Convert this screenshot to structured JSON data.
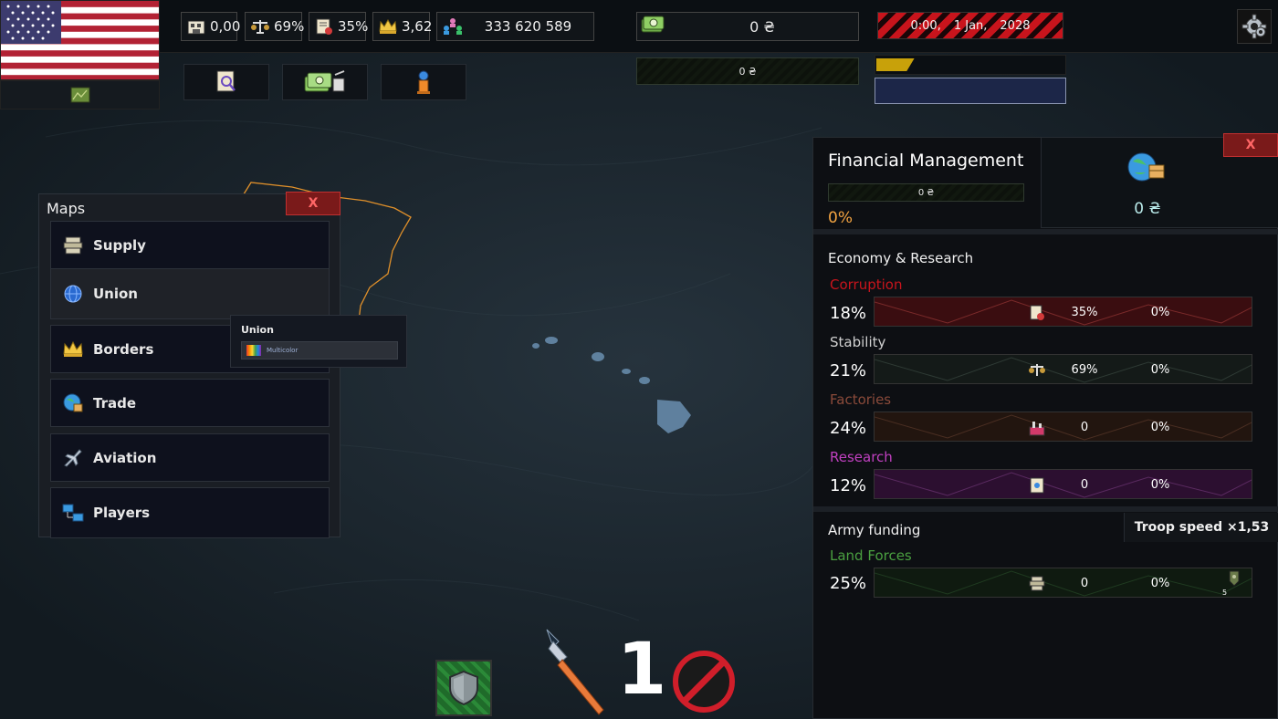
{
  "top_bar": {
    "stats": [
      {
        "icon": "factory-building-icon",
        "value": "0,00"
      },
      {
        "icon": "balance-scale-icon",
        "value": "69%"
      },
      {
        "icon": "document-seal-icon",
        "value": "35%"
      },
      {
        "icon": "crown-icon",
        "value": "3,62"
      },
      {
        "icon": "population-icon",
        "value": "333 620 589"
      }
    ],
    "money": "0 ₴",
    "sub_money": "0 ₴",
    "date": {
      "time": "0:00,",
      "day": "1 Jan,",
      "year": "2028"
    },
    "progress": {
      "yellow_fraction": 0.2
    }
  },
  "maps_panel": {
    "title": "Maps",
    "close_label": "X",
    "items": [
      {
        "label": "Supply",
        "icon": "supply-icon"
      },
      {
        "label": "Union",
        "icon": "globe-icon"
      },
      {
        "label": "Borders",
        "icon": "crown-icon"
      },
      {
        "label": "Trade",
        "icon": "trade-globe-icon"
      },
      {
        "label": "Aviation",
        "icon": "jet-icon"
      },
      {
        "label": "Players",
        "icon": "players-icon"
      }
    ],
    "tooltip": {
      "title": "Union",
      "option": "Multicolor"
    }
  },
  "finance": {
    "title": "Financial Management",
    "bar_value": "0 ₴",
    "percent": "0%",
    "right_value": "0 ₴",
    "close_label": "X",
    "economy_title": "Economy & Research",
    "rows": [
      {
        "label": "Corruption",
        "pct": "18%",
        "v1": "35%",
        "v2": "0%",
        "color": "#c8141c"
      },
      {
        "label": "Stability",
        "pct": "21%",
        "v1": "69%",
        "v2": "0%",
        "color": "#d0d0d0"
      },
      {
        "label": "Factories",
        "pct": "24%",
        "v1": "0",
        "v2": "0%",
        "color": "#8a4a3a"
      },
      {
        "label": "Research",
        "pct": "12%",
        "v1": "0",
        "v2": "0%",
        "color": "#c040c0"
      }
    ],
    "army_title": "Army funding",
    "troop_speed": "Troop speed ×1,53",
    "land": {
      "label": "Land Forces",
      "pct": "25%",
      "v1": "0",
      "v2": "0%",
      "count": "5",
      "color": "#4aa040"
    }
  },
  "bottom": {
    "brush_count": "1"
  }
}
